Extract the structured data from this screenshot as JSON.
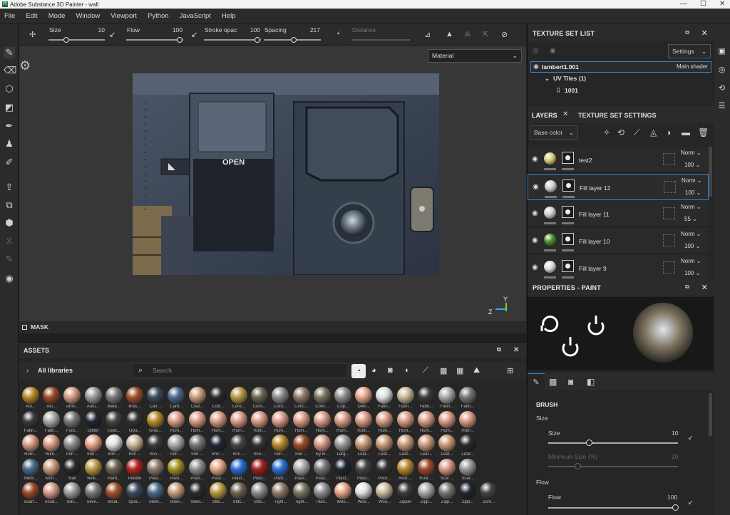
{
  "window": {
    "title": "Adobe Substance 3D Painter - wall",
    "app_icon": "Pt"
  },
  "menu": [
    "File",
    "Edit",
    "Mode",
    "Window",
    "Viewport",
    "Python",
    "JavaScript",
    "Help"
  ],
  "toolbar": {
    "size_label": "Size",
    "size_value": "10",
    "flow_label": "Flow",
    "flow_value": "100",
    "stroke_label": "Stroke opac",
    "stroke_value": "100",
    "spacing_label": "Spacing",
    "spacing_value": "217",
    "distance_label": "Distance"
  },
  "viewport": {
    "material_dropdown": "Material",
    "open_sign": "OPEN",
    "axis_y": "Y",
    "axis_z": "Z"
  },
  "mask": {
    "label": "MASK"
  },
  "assets": {
    "title": "ASSETS",
    "library": "All libraries",
    "search_placeholder": "Search",
    "rows": [
      [
        "Alu...",
        "Alu...",
        "Artifi...",
        "Autu...",
        "Bake...",
        "Bras...",
        "Calf ...",
        "Carb...",
        "Coat...",
        "Cob...",
        "Conc...",
        "Conc...",
        "Conc...",
        "Conc...",
        "Conc...",
        "Cop...",
        "Deni...",
        "Fabri...",
        "Fabri...",
        "Fabri...",
        "Fabri...",
        "Fabri..."
      ],
      [
        "Fabri...",
        "Fabri...",
        "Foot...",
        "Glitter",
        "Gold...",
        "Gou...",
        "Grou...",
        "Hum...",
        "Hum...",
        "Hum...",
        "Hum...",
        "Hum...",
        "Hum...",
        "Hum...",
        "Hum...",
        "Hum...",
        "Hum...",
        "Hum...",
        "Hum...",
        "Hum...",
        "Hum...",
        "Hum..."
      ],
      [
        "Hum...",
        "Hum...",
        "Iron ...",
        "Iron ...",
        "Iron ...",
        "Iron ...",
        "Iron ...",
        "Iron ...",
        "Iron ...",
        "Iron ...",
        "Iron ...",
        "Iron ...",
        "Iron ...",
        "Iron ...",
        "Ivy B...",
        "Larg...",
        "Leat...",
        "Leat...",
        "Leat...",
        "Leat...",
        "Leat...",
        "Lizar..."
      ],
      [
        "Medi...",
        "Mort...",
        "Nail",
        "Nick...",
        "Paint...",
        "Pebble",
        "Plast...",
        "Plast...",
        "Plast...",
        "Plast...",
        "Plast...",
        "Plast...",
        "Plast...",
        "Plast...",
        "Plast...",
        "Plast...",
        "Plast...",
        "Pock...",
        "Rust ...",
        "Rust ...",
        "Scar ...",
        "Scar..."
      ],
      [
        "Scarf...",
        "Scrat...",
        "Silic...",
        "Silve...",
        "Smal...",
        "Spra...",
        "Steel...",
        "Steel...",
        "Steel...",
        "Stitc...",
        "Stitc...",
        "Stitc...",
        "Tight...",
        "Tight...",
        "Titan...",
        "Woo...",
        "Woo...",
        "Woo...",
        "Zipper",
        "Zipp...",
        "Zipp...",
        "Zipp...",
        "Zom..."
      ]
    ]
  },
  "texture_set_list": {
    "title": "TEXTURE SET LIST",
    "settings": "Settings",
    "set_name": "lambert1.001",
    "shader": "Main shader",
    "uv_tiles": "UV Tiles (1)",
    "tile": "1001"
  },
  "layers": {
    "tab_layers": "LAYERS",
    "tab_settings": "TEXTURE SET SETTINGS",
    "channel": "Base color",
    "items": [
      {
        "name": "test2",
        "blend": "Norm",
        "opacity": "100"
      },
      {
        "name": "Fill layer 12",
        "blend": "Norm",
        "opacity": "100"
      },
      {
        "name": "Fill layer 11",
        "blend": "Norm",
        "opacity": "55"
      },
      {
        "name": "Fill layer 10",
        "blend": "Norm",
        "opacity": "100"
      },
      {
        "name": "Fill layer 9",
        "blend": "Norm",
        "opacity": "100"
      }
    ]
  },
  "properties": {
    "title": "PROPERTIES - PAINT",
    "brush": "BRUSH",
    "size_section": "Size",
    "size_label": "Size",
    "size_value": "10",
    "min_size_label": "Minimum Size (%)",
    "min_size_value": "20",
    "flow_section": "Flow",
    "flow_label": "Flow",
    "flow_value": "100"
  },
  "colors": {
    "accent": "#2f86d8",
    "panel": "#262626",
    "bar": "#2b2b2b"
  }
}
